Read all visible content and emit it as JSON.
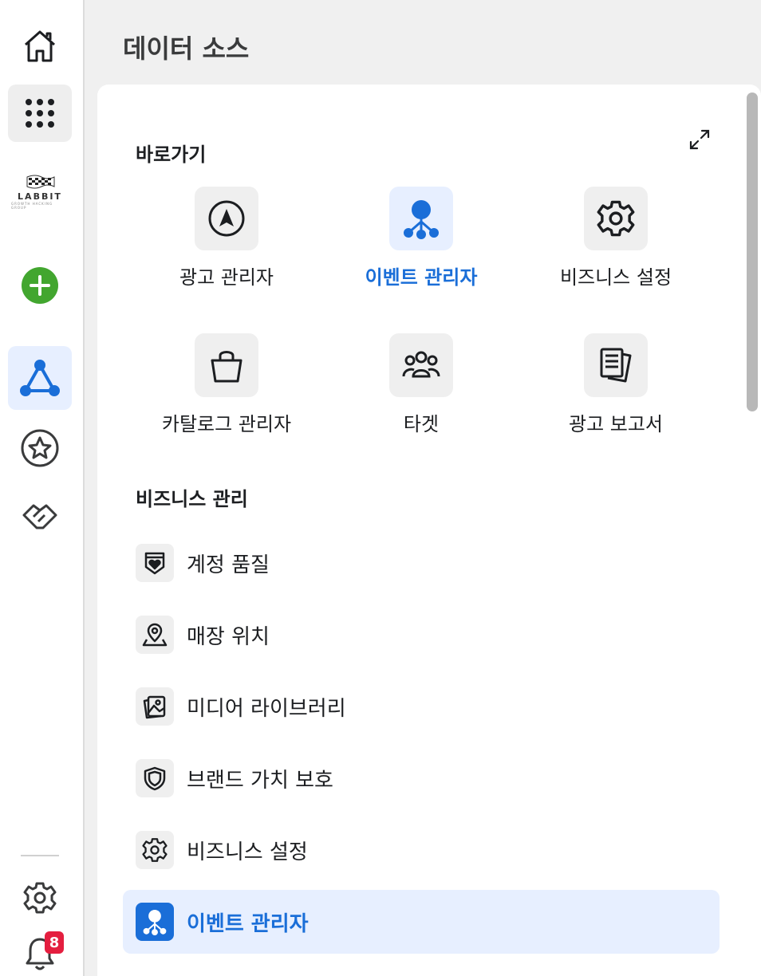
{
  "header": {
    "title": "데이터 소스"
  },
  "rail": {
    "logo_text": "LABBIT",
    "logo_subtext": "GROWTH HACKING GROUP",
    "notification_count": "8"
  },
  "shortcuts": {
    "title": "바로가기",
    "items": [
      {
        "label": "광고 관리자",
        "icon": "navigation-arrow-icon"
      },
      {
        "label": "이벤트 관리자",
        "icon": "event-nodes-icon"
      },
      {
        "label": "비즈니스 설정",
        "icon": "gear-icon"
      },
      {
        "label": "카탈로그 관리자",
        "icon": "shopping-bag-icon"
      },
      {
        "label": "타겟",
        "icon": "people-group-icon"
      },
      {
        "label": "광고 보고서",
        "icon": "report-documents-icon"
      }
    ]
  },
  "business": {
    "title": "비즈니스 관리",
    "items": [
      {
        "label": "계정 품질",
        "icon": "shield-heart-icon"
      },
      {
        "label": "매장 위치",
        "icon": "map-pin-icon"
      },
      {
        "label": "미디어 라이브러리",
        "icon": "media-image-icon"
      },
      {
        "label": "브랜드 가치 보호",
        "icon": "shield-icon"
      },
      {
        "label": "비즈니스 설정",
        "icon": "gear-icon"
      },
      {
        "label": "이벤트 관리자",
        "icon": "event-nodes-icon"
      }
    ]
  },
  "colors": {
    "accent": "#1a6ed8",
    "add": "#42a62f",
    "badge": "#e41e3f"
  }
}
